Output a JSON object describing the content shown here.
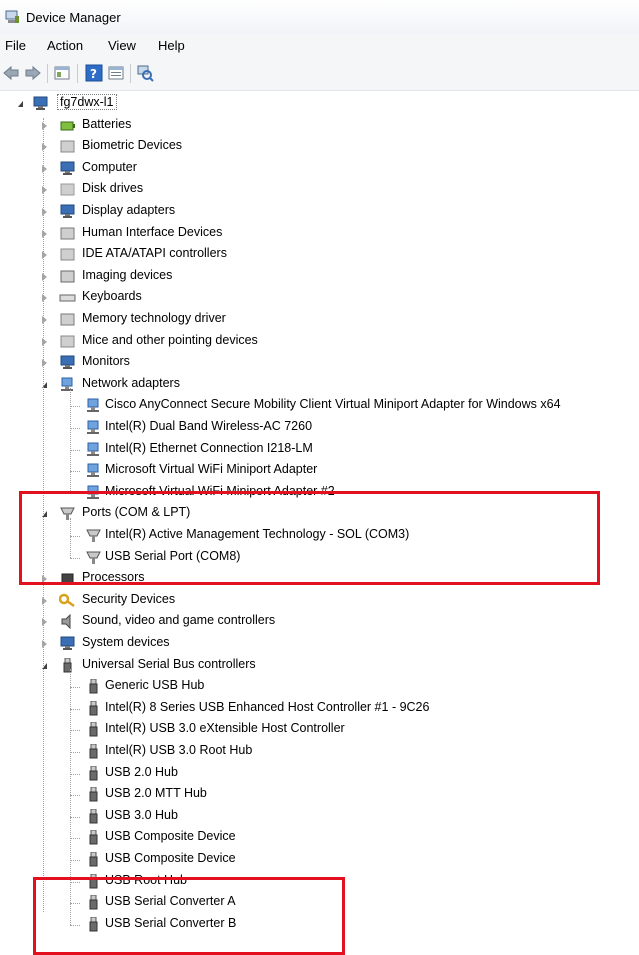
{
  "window": {
    "title": "Device Manager"
  },
  "menu": [
    "File",
    "Action",
    "View",
    "Help"
  ],
  "toolbar": {
    "buttons": [
      {
        "icon": "back-arrow-icon"
      },
      {
        "icon": "forward-arrow-icon"
      },
      {
        "icon": "properties-icon"
      },
      {
        "icon": "help-icon"
      },
      {
        "icon": "show-hide-console-tree-icon"
      },
      {
        "icon": "scan-hardware-changes-icon"
      }
    ]
  },
  "tree": {
    "root": {
      "label": "fg7dwx-l1",
      "icon": "computer-icon",
      "expanded": true
    },
    "items": [
      {
        "label": "Batteries",
        "icon": "battery-icon",
        "level": 1,
        "state": "collapsed"
      },
      {
        "label": "Biometric Devices",
        "icon": "fingerprint-icon",
        "level": 1,
        "state": "collapsed"
      },
      {
        "label": "Computer",
        "icon": "computer-icon",
        "level": 1,
        "state": "collapsed"
      },
      {
        "label": "Disk drives",
        "icon": "disk-drive-icon",
        "level": 1,
        "state": "collapsed"
      },
      {
        "label": "Display adapters",
        "icon": "display-adapter-icon",
        "level": 1,
        "state": "collapsed"
      },
      {
        "label": "Human Interface Devices",
        "icon": "hid-icon",
        "level": 1,
        "state": "collapsed"
      },
      {
        "label": "IDE ATA/ATAPI controllers",
        "icon": "ide-controller-icon",
        "level": 1,
        "state": "collapsed"
      },
      {
        "label": "Imaging devices",
        "icon": "camera-icon",
        "level": 1,
        "state": "collapsed"
      },
      {
        "label": "Keyboards",
        "icon": "keyboard-icon",
        "level": 1,
        "state": "collapsed"
      },
      {
        "label": "Memory technology driver",
        "icon": "memory-icon",
        "level": 1,
        "state": "collapsed"
      },
      {
        "label": "Mice and other pointing devices",
        "icon": "mouse-icon",
        "level": 1,
        "state": "collapsed"
      },
      {
        "label": "Monitors",
        "icon": "monitor-icon",
        "level": 1,
        "state": "collapsed"
      },
      {
        "label": "Network adapters",
        "icon": "network-adapter-icon",
        "level": 1,
        "state": "expanded"
      },
      {
        "label": "Cisco AnyConnect Secure Mobility Client Virtual Miniport Adapter for Windows x64",
        "icon": "network-adapter-icon",
        "level": 2
      },
      {
        "label": "Intel(R) Dual Band Wireless-AC 7260",
        "icon": "network-adapter-icon",
        "level": 2
      },
      {
        "label": "Intel(R) Ethernet Connection I218-LM",
        "icon": "network-adapter-icon",
        "level": 2
      },
      {
        "label": "Microsoft Virtual WiFi Miniport Adapter",
        "icon": "network-adapter-icon",
        "level": 2
      },
      {
        "label": "Microsoft Virtual WiFi Miniport Adapter #2",
        "icon": "network-adapter-icon",
        "level": 2
      },
      {
        "label": "Ports (COM & LPT)",
        "icon": "port-icon",
        "level": 1,
        "state": "expanded"
      },
      {
        "label": "Intel(R) Active Management Technology - SOL (COM3)",
        "icon": "port-icon",
        "level": 2
      },
      {
        "label": "USB Serial Port (COM8)",
        "icon": "port-icon",
        "level": 2
      },
      {
        "label": "Processors",
        "icon": "processor-icon",
        "level": 1,
        "state": "collapsed"
      },
      {
        "label": "Security Devices",
        "icon": "key-icon",
        "level": 1,
        "state": "collapsed"
      },
      {
        "label": "Sound, video and game controllers",
        "icon": "speaker-icon",
        "level": 1,
        "state": "collapsed"
      },
      {
        "label": "System devices",
        "icon": "system-device-icon",
        "level": 1,
        "state": "collapsed"
      },
      {
        "label": "Universal Serial Bus controllers",
        "icon": "usb-icon",
        "level": 1,
        "state": "expanded"
      },
      {
        "label": "Generic USB Hub",
        "icon": "usb-icon",
        "level": 2
      },
      {
        "label": "Intel(R) 8 Series USB Enhanced Host Controller #1 - 9C26",
        "icon": "usb-icon",
        "level": 2
      },
      {
        "label": "Intel(R) USB 3.0 eXtensible Host Controller",
        "icon": "usb-icon",
        "level": 2
      },
      {
        "label": "Intel(R) USB 3.0 Root Hub",
        "icon": "usb-icon",
        "level": 2
      },
      {
        "label": "USB 2.0 Hub",
        "icon": "usb-icon",
        "level": 2
      },
      {
        "label": "USB 2.0 MTT Hub",
        "icon": "usb-icon",
        "level": 2
      },
      {
        "label": "USB 3.0 Hub",
        "icon": "usb-icon",
        "level": 2
      },
      {
        "label": "USB Composite Device",
        "icon": "usb-icon",
        "level": 2
      },
      {
        "label": "USB Composite Device",
        "icon": "usb-icon",
        "level": 2
      },
      {
        "label": "USB Root Hub",
        "icon": "usb-icon",
        "level": 2
      },
      {
        "label": "USB Serial Converter A",
        "icon": "usb-icon",
        "level": 2
      },
      {
        "label": "USB Serial Converter B",
        "icon": "usb-icon",
        "level": 2
      }
    ]
  },
  "annotations": {
    "highlight_color": "#e3101f"
  }
}
